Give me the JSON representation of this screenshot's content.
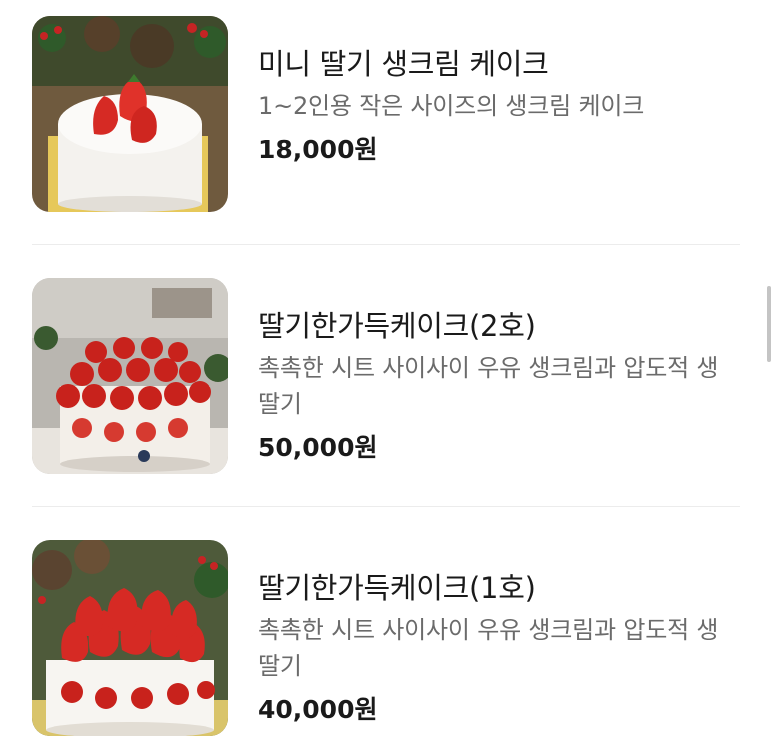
{
  "menu": {
    "items": [
      {
        "name": "미니 딸기 생크림 케이크",
        "description": "1~2인용 작은 사이즈의 생크림 케이크",
        "price": "18,000원",
        "image_icon": "strawberry-cake-image-icon"
      },
      {
        "name": "딸기한가득케이크(2호)",
        "description": "촉촉한 시트 사이사이 우유 생크림과 압도적 생딸기",
        "price": "50,000원",
        "image_icon": "strawberry-cake-image-icon"
      },
      {
        "name": "딸기한가득케이크(1호)",
        "description": "촉촉한 시트 사이사이 우유 생크림과 압도적 생딸기",
        "price": "40,000원",
        "image_icon": "strawberry-cake-image-icon"
      }
    ]
  },
  "colors": {
    "text_primary": "#1a1a1a",
    "text_secondary": "#6b6b6b",
    "divider": "#ececec",
    "strawberry": "#d62a24",
    "cream": "#f7f5f1"
  }
}
